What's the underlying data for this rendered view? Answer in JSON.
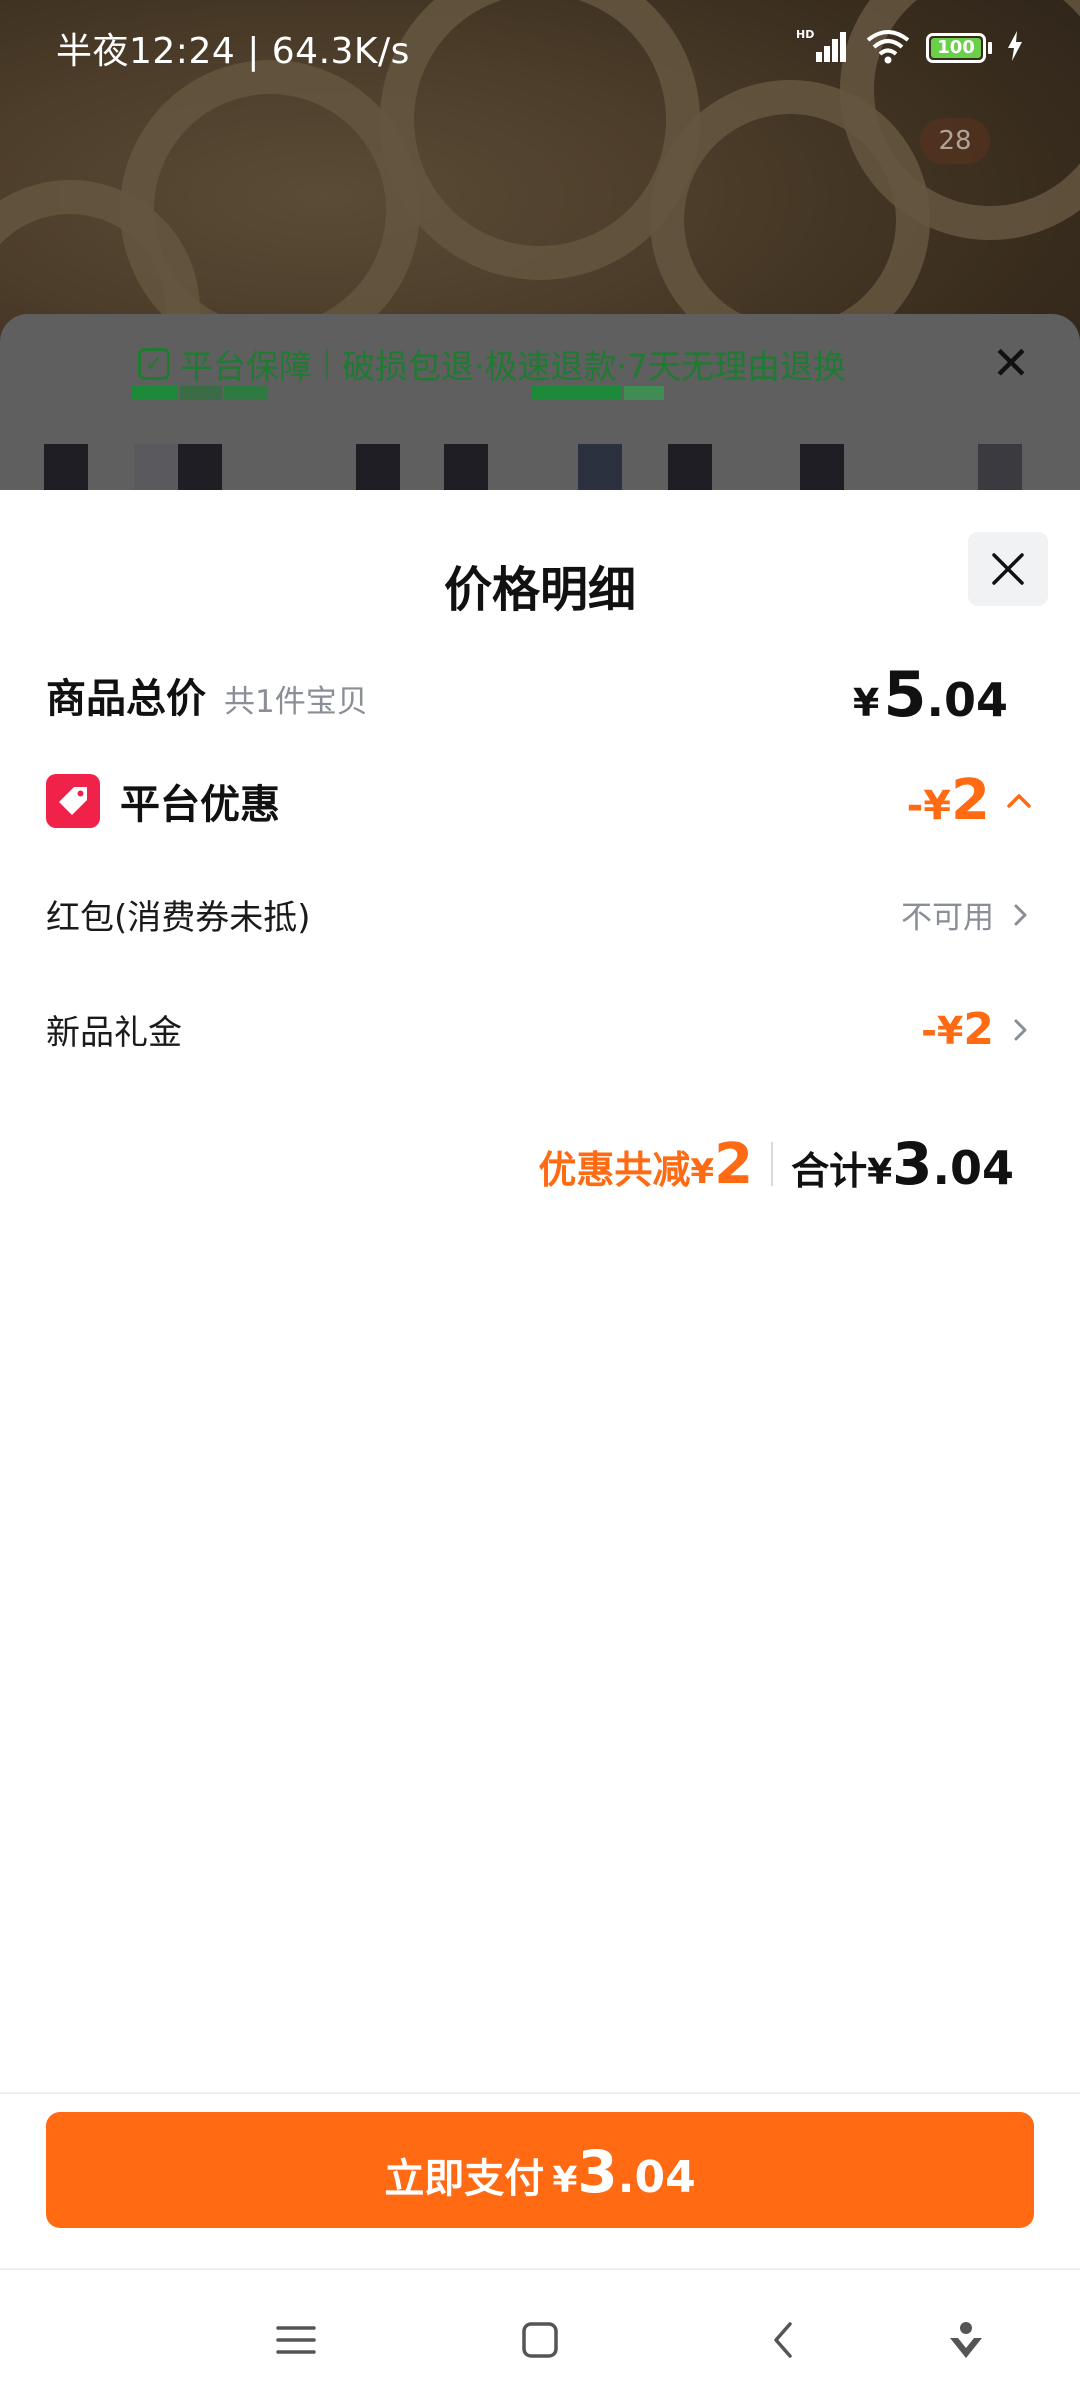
{
  "status_bar": {
    "time_text": "半夜12:24 | 64.3K/s",
    "hd_label": "HD",
    "battery_level": "100"
  },
  "background": {
    "cart_badge": "28"
  },
  "guarantee": {
    "title": "平台保障",
    "items": "破损包退·极速退款·7天无理由退换"
  },
  "sheet": {
    "title": "价格明细",
    "total_row": {
      "label": "商品总价",
      "sub_label": "共1件宝贝",
      "price_yen": "¥",
      "price_int": "5",
      "price_dec": ".04"
    },
    "platform_row": {
      "label": "平台优惠",
      "minus": "-",
      "yen": "¥",
      "amount": "2"
    },
    "red_packet_row": {
      "label": "红包(消费券未抵)",
      "status": "不可用"
    },
    "new_gift_row": {
      "label": "新品礼金",
      "minus": "-",
      "yen": "¥",
      "amount": "2"
    },
    "summary": {
      "discount_label": "优惠共减",
      "discount_yen": "¥",
      "discount_amount": "2",
      "total_label": "合计",
      "total_yen": "¥",
      "total_int": "3",
      "total_dec": ".04"
    }
  },
  "pay_button": {
    "label": "立即支付",
    "yen": "¥",
    "int": "3",
    "dec": ".04"
  },
  "colors": {
    "accent": "#ff6a12",
    "tag_red": "#f0224a",
    "guarantee_green": "#1f7a32"
  },
  "icons": {
    "status": [
      "signal-icon",
      "wifi-icon",
      "battery-icon",
      "charging-icon"
    ],
    "nav": [
      "menu-icon",
      "home-icon",
      "back-icon",
      "assistant-icon"
    ]
  }
}
